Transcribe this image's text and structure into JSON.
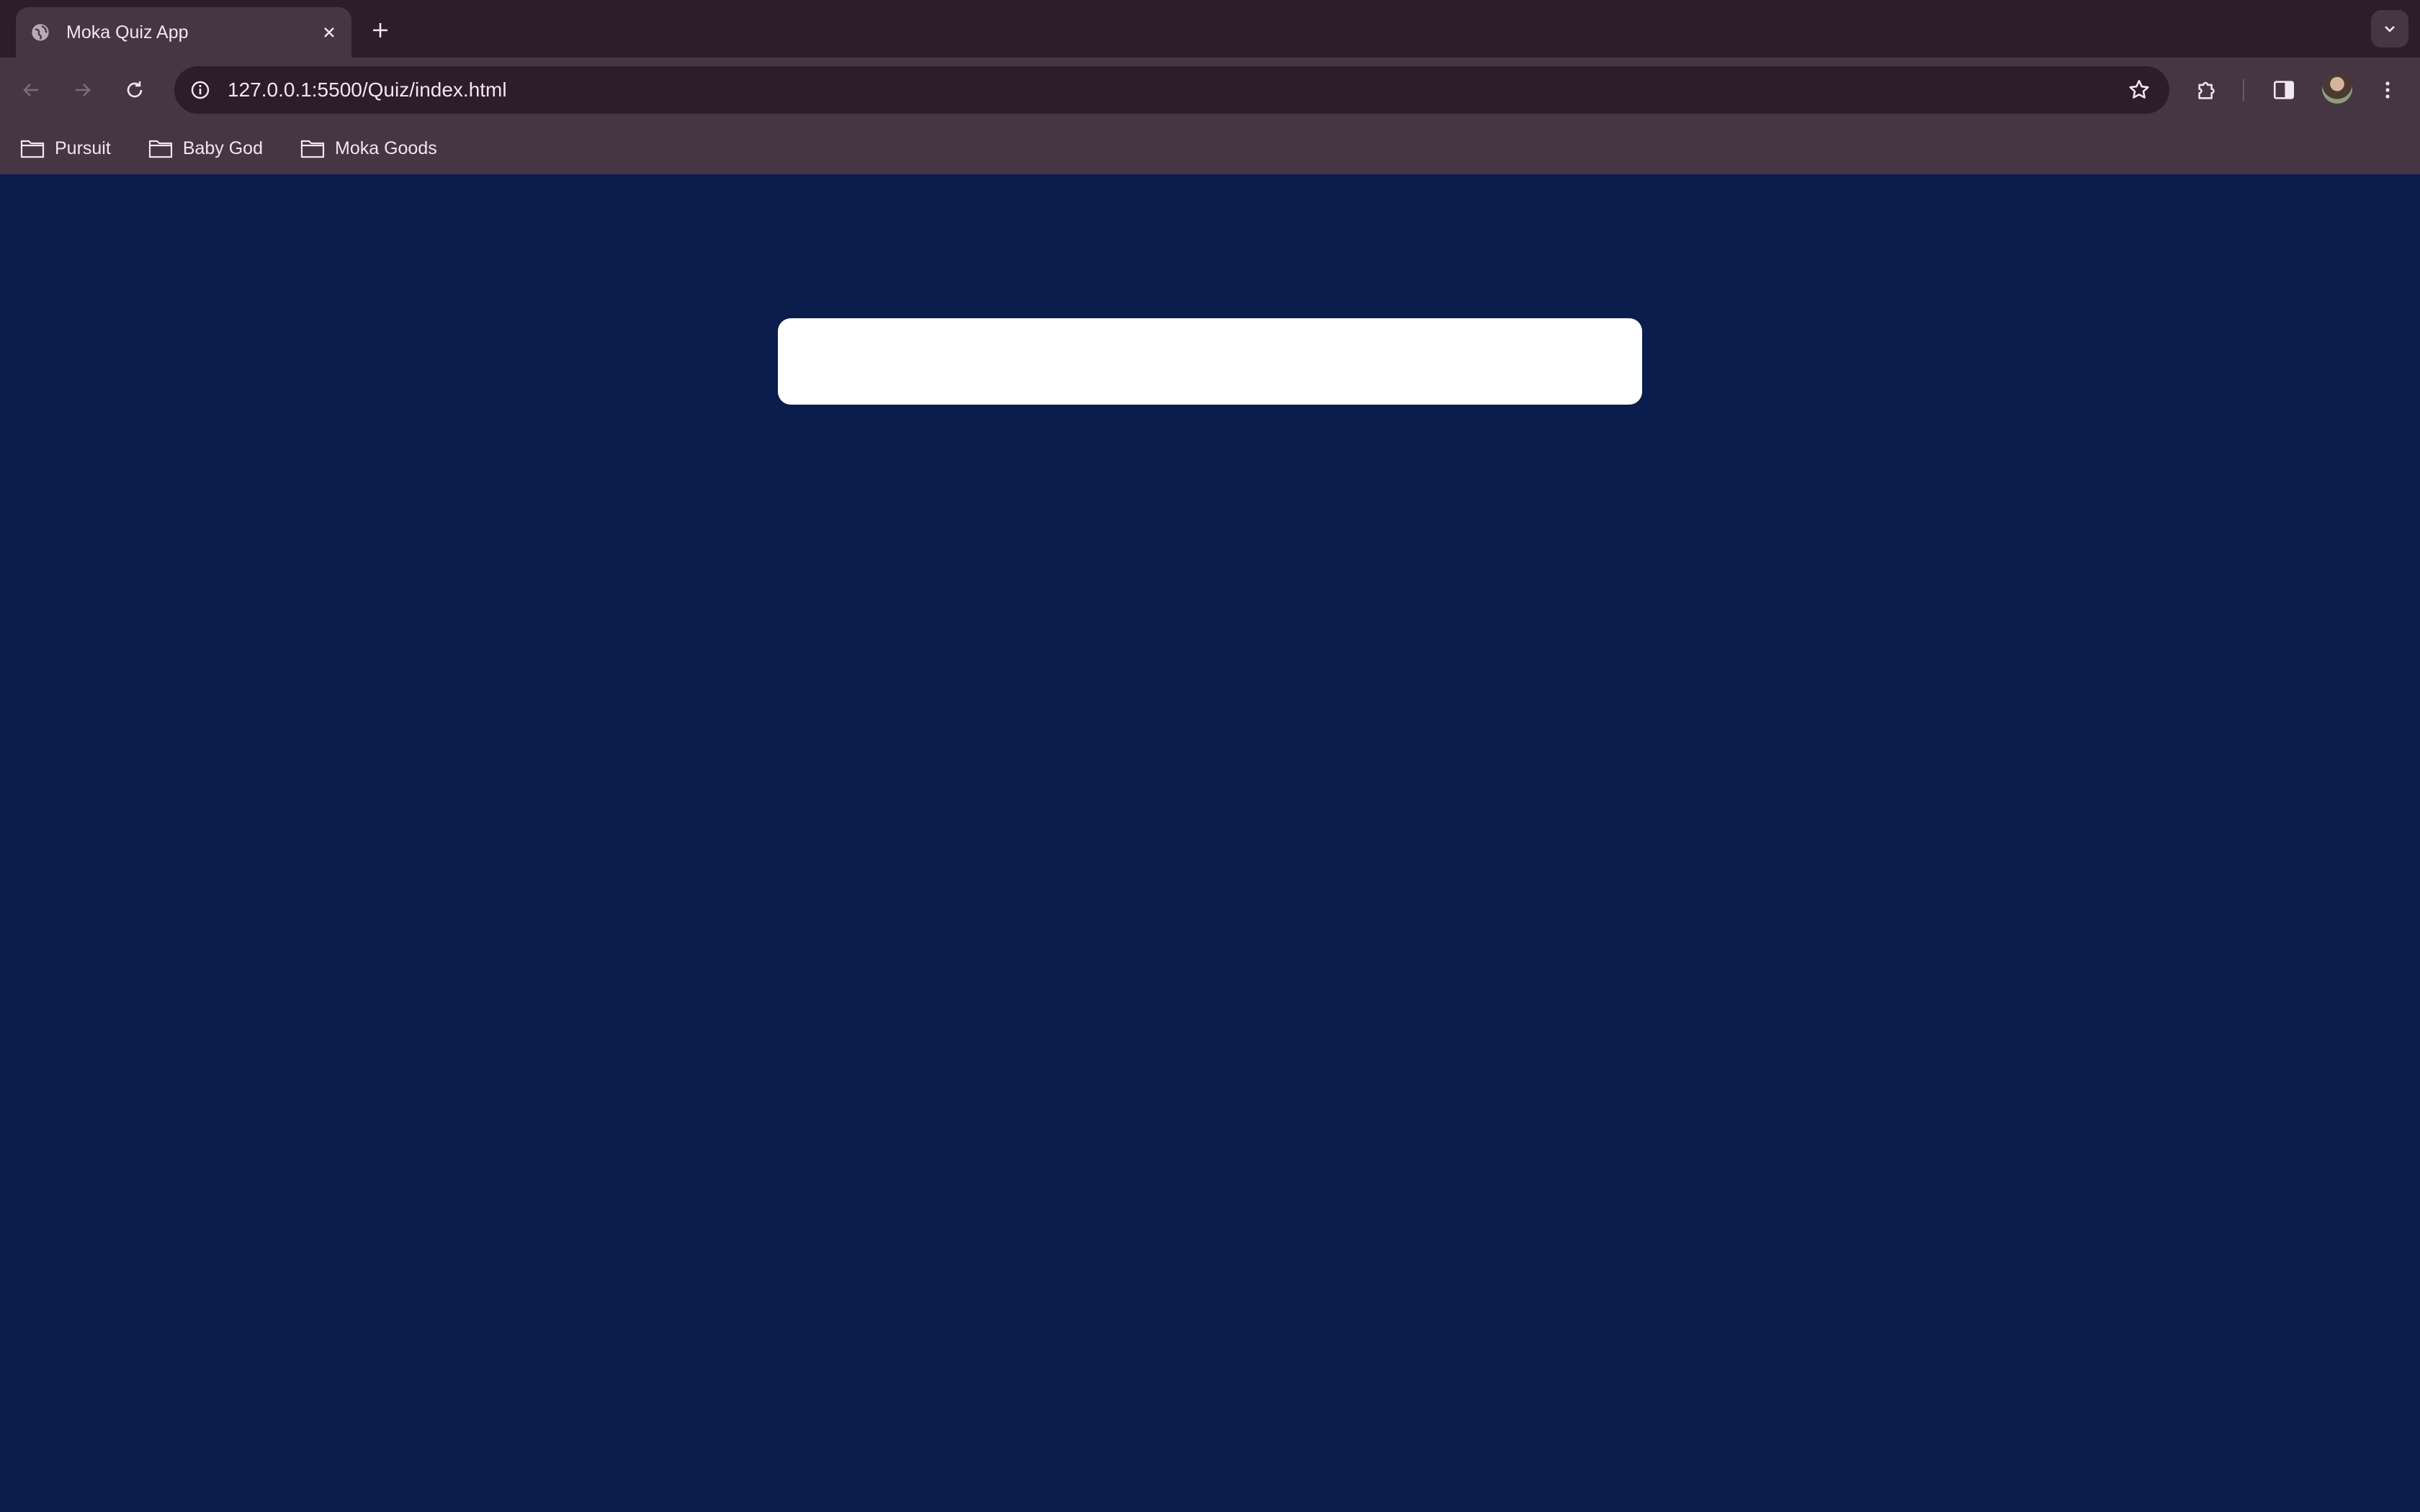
{
  "browser": {
    "tab": {
      "title": "Moka Quiz App",
      "favicon": "globe-icon"
    },
    "address_bar": {
      "url": "127.0.0.1:5500/Quiz/index.html"
    },
    "bookmarks": [
      {
        "label": "Pursuit",
        "icon": "folder-icon"
      },
      {
        "label": "Baby God",
        "icon": "folder-icon"
      },
      {
        "label": "Moka Goods",
        "icon": "folder-icon"
      }
    ]
  },
  "colors": {
    "page_background": "#0a1d4c",
    "card_background": "#ffffff",
    "tabstrip": "#2d1c29",
    "toolbar": "#463542"
  }
}
